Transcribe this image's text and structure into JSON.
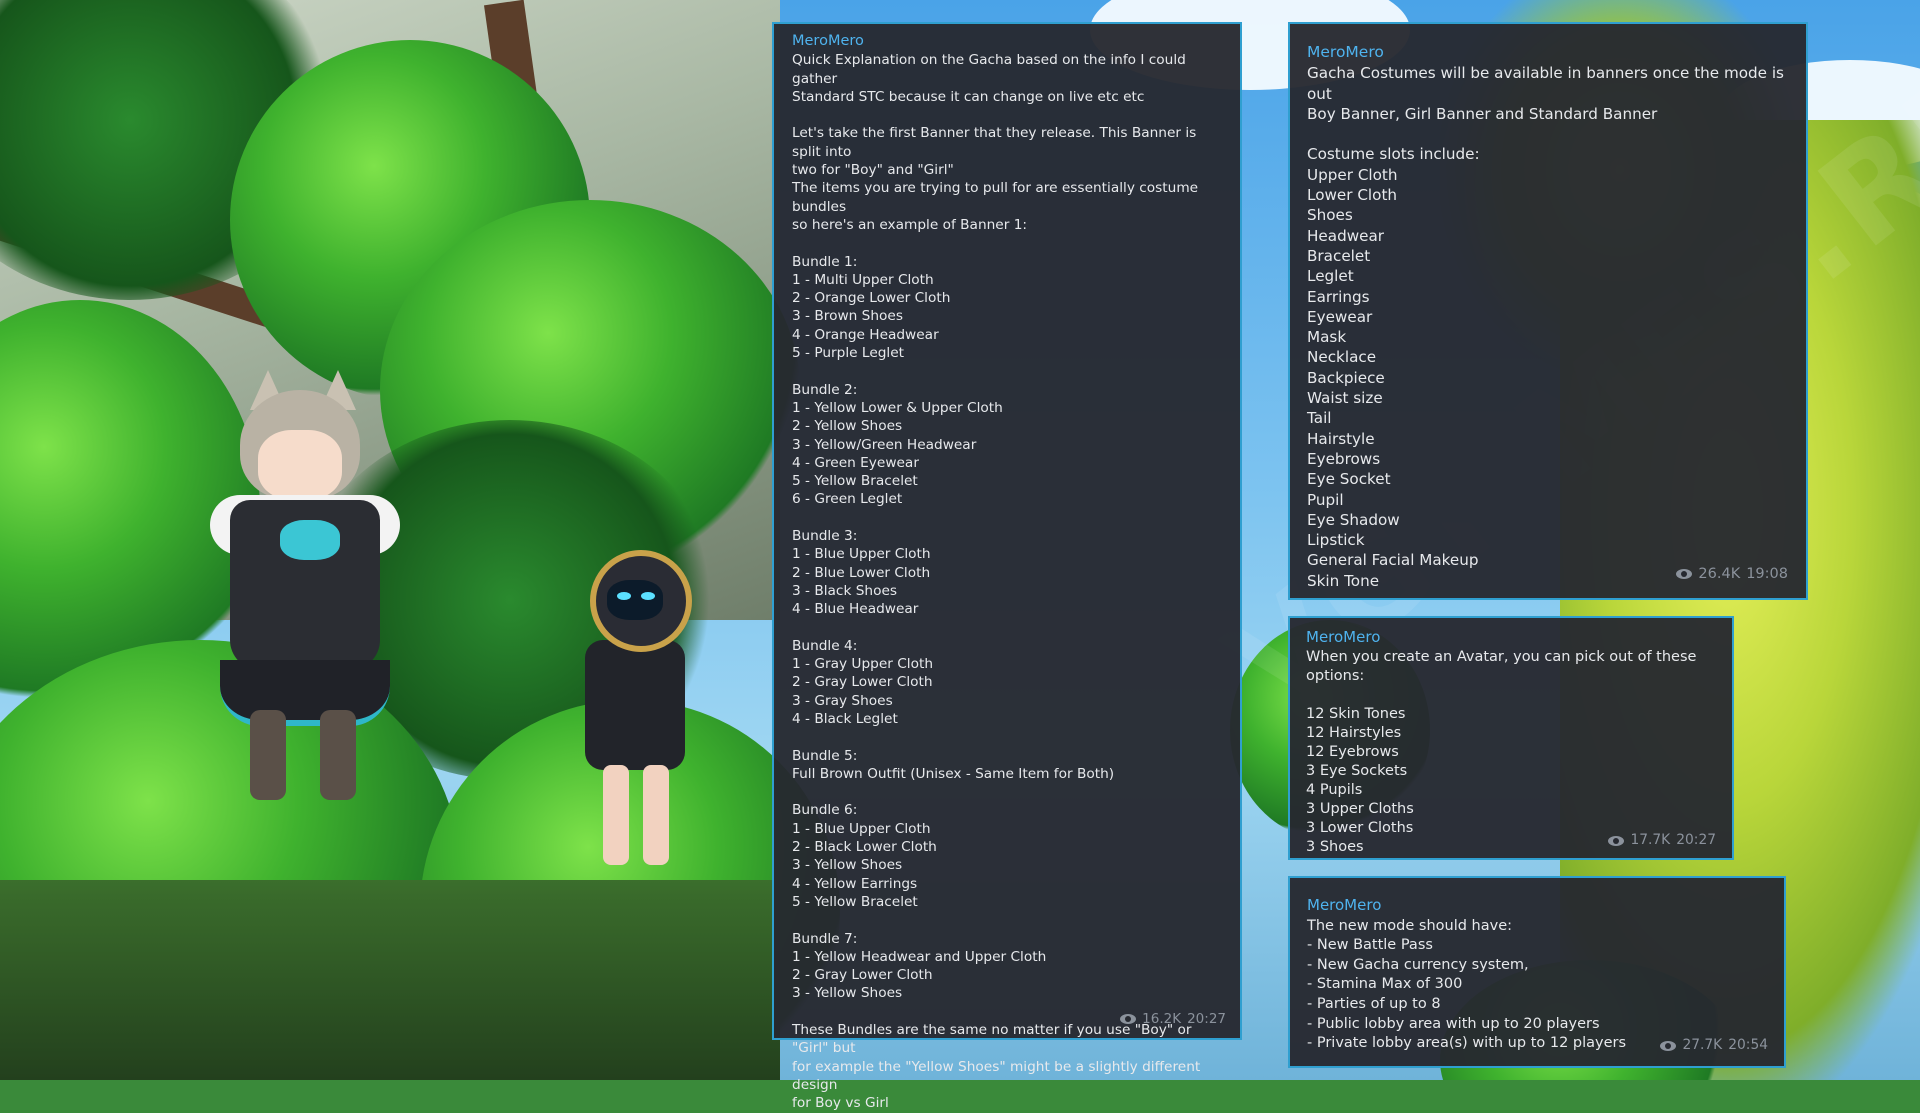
{
  "watermark": "VGTIMES.RU",
  "messages": [
    {
      "author": "MeroMero",
      "text": "Quick Explanation on the Gacha based on the info I could gather\nStandard STC because it can change on live etc etc\n\nLet's take the first Banner that they release. This Banner is split into\ntwo for \"Boy\" and \"Girl\"\nThe items you are trying to pull for are essentially costume bundles\nso here's an example of Banner 1:\n\nBundle 1:\n1 - Multi Upper Cloth\n2 - Orange Lower Cloth\n3 - Brown Shoes\n4 - Orange Headwear\n5 - Purple Leglet\n\nBundle 2:\n1 - Yellow Lower & Upper Cloth\n2 - Yellow Shoes\n3 - Yellow/Green Headwear\n4 - Green Eyewear\n5 - Yellow Bracelet\n6 - Green Leglet\n\nBundle 3:\n1 - Blue Upper Cloth\n2 - Blue Lower Cloth\n3 - Black Shoes\n4 - Blue Headwear\n\nBundle 4:\n1 - Gray Upper Cloth\n2 - Gray Lower Cloth\n3 - Gray Shoes\n4 - Black Leglet\n\nBundle 5:\nFull Brown Outfit (Unisex - Same Item for Both)\n\nBundle 6:\n1 - Blue Upper Cloth\n2 - Black Lower Cloth\n3 - Yellow Shoes\n4 - Yellow Earrings\n5 - Yellow Bracelet\n\nBundle 7:\n1 - Yellow Headwear and Upper Cloth\n2 - Gray Lower Cloth\n3 - Yellow Shoes\n\nThese Bundles are the same no matter if you use \"Boy\" or \"Girl\" but\nfor example the \"Yellow Shoes\" might be a slightly different design\nfor Boy vs Girl",
      "views": "16.2K",
      "time": "20:27"
    },
    {
      "author": "MeroMero",
      "text": "Gacha Costumes will be available in banners once the mode is out\nBoy Banner, Girl Banner and Standard Banner\n\nCostume slots include:\nUpper Cloth\nLower Cloth\nShoes\nHeadwear\nBracelet\nLeglet\nEarrings\nEyewear\nMask\nNecklace\nBackpiece\nWaist size\nTail\nHairstyle\nEyebrows\nEye Socket\nPupil\nEye Shadow\nLipstick\nGeneral Facial Makeup\nSkin Tone",
      "views": "26.4K",
      "time": "19:08"
    },
    {
      "author": "MeroMero",
      "text": "When you create an Avatar, you can pick out of these options:\n\n12 Skin Tones\n12 Hairstyles\n12 Eyebrows\n3 Eye Sockets\n4 Pupils\n3 Upper Cloths\n3 Lower Cloths\n3 Shoes",
      "views": "17.7K",
      "time": "20:27"
    },
    {
      "author": "MeroMero",
      "text": "The new mode should have:\n- New Battle Pass\n- New Gacha currency system,\n- Stamina Max of 300\n- Parties of up to 8\n- Public lobby area with up to 20 players\n- Private lobby area(s) with up to 12 players",
      "views": "27.7K",
      "time": "20:54"
    }
  ]
}
